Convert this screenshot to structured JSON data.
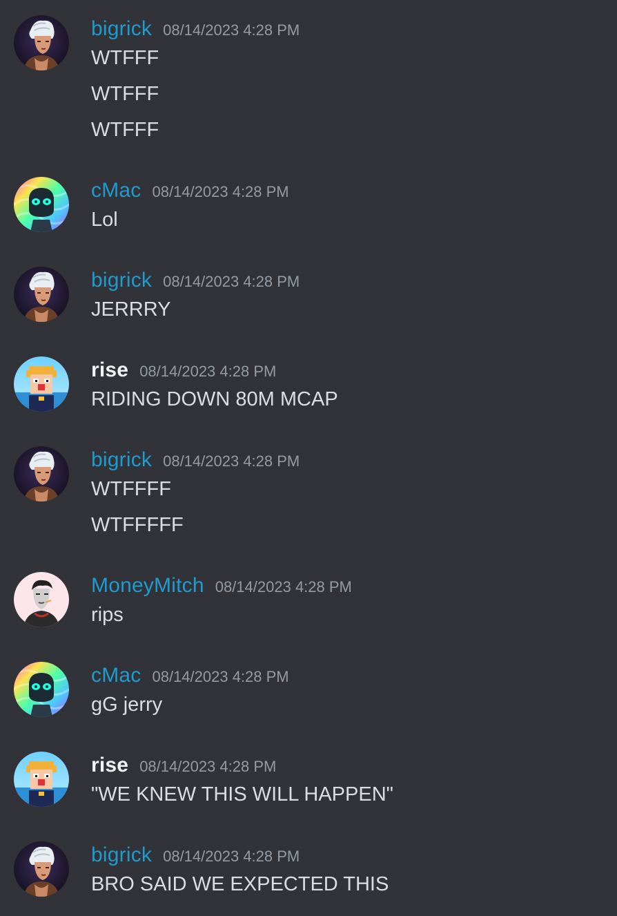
{
  "timestamp": "08/14/2023 4:28 PM",
  "messages": [
    {
      "author": "bigrick",
      "avatar": "bigrick-avatar-icon",
      "lines": [
        "WTFFF",
        "WTFFF",
        "WTFFF"
      ]
    },
    {
      "author": "cMac",
      "avatar": "cmac-avatar-icon",
      "lines": [
        "Lol"
      ]
    },
    {
      "author": "bigrick",
      "avatar": "bigrick-avatar-icon",
      "lines": [
        "JERRRY"
      ]
    },
    {
      "author": "rise",
      "avatar": "rise-avatar-icon",
      "lines": [
        "RIDING DOWN 80M MCAP"
      ]
    },
    {
      "author": "bigrick",
      "avatar": "bigrick-avatar-icon",
      "lines": [
        "WTFFFF",
        "WTFFFFF"
      ]
    },
    {
      "author": "MoneyMitch",
      "avatar": "moneymitch-avatar-icon",
      "lines": [
        "rips"
      ]
    },
    {
      "author": "cMac",
      "avatar": "cmac-avatar-icon",
      "lines": [
        "gG jerry"
      ]
    },
    {
      "author": "rise",
      "avatar": "rise-avatar-icon",
      "lines": [
        "\"WE KNEW THIS WILL HAPPEN\""
      ]
    },
    {
      "author": "bigrick",
      "avatar": "bigrick-avatar-icon",
      "lines": [
        "BRO SAID WE EXPECTED THIS"
      ]
    }
  ],
  "colors": {
    "background": "#313338",
    "username_blue": "#1f9bcf",
    "username_white": "#f2f3f5",
    "timestamp": "#949ba4",
    "message_text": "#dbdee1"
  }
}
